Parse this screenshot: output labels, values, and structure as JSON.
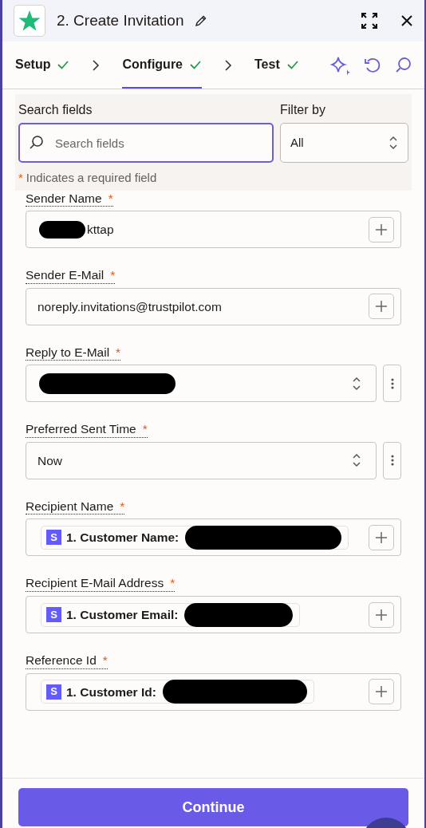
{
  "header": {
    "title": "2. Create Invitation"
  },
  "steps": [
    {
      "label": "Setup",
      "done": true,
      "selected": false
    },
    {
      "label": "Configure",
      "done": true,
      "selected": true
    },
    {
      "label": "Test",
      "done": true,
      "selected": false
    }
  ],
  "search": {
    "label": "Search fields",
    "placeholder": "Search fields"
  },
  "filter": {
    "label": "Filter by",
    "value": "All"
  },
  "required_note": {
    "mark": "*",
    "text": "Indicates a required field"
  },
  "fields": [
    {
      "kind": "text",
      "label": "Sender Name",
      "required": true,
      "redacted": true,
      "value": "kttap"
    },
    {
      "kind": "text",
      "label": "Sender E-Mail",
      "required": true,
      "redacted": false,
      "value": "noreply.invitations@trustpilot.com"
    },
    {
      "kind": "select",
      "label": "Reply to E-Mail",
      "required": true,
      "redacted": true
    },
    {
      "kind": "select",
      "label": "Preferred Sent Time",
      "required": true,
      "redacted": false,
      "value": "Now"
    },
    {
      "kind": "pill",
      "label": "Recipient Name",
      "required": true,
      "redacted": true,
      "pill_icon": "S",
      "pill_label": "1. Customer Name:"
    },
    {
      "kind": "pill",
      "label": "Recipient E-Mail Address",
      "required": true,
      "redacted": true,
      "pill_icon": "S",
      "pill_label": "1. Customer Email:"
    },
    {
      "kind": "pill",
      "label": "Reference Id",
      "required": true,
      "redacted": true,
      "pill_icon": "S",
      "pill_label": "1. Customer Id:"
    }
  ],
  "continue_button": "Continue"
}
